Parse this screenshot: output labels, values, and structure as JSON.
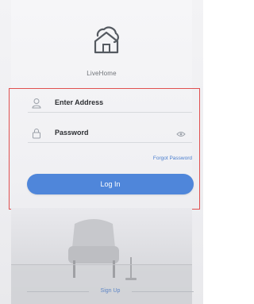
{
  "brand": {
    "name": "LiveHome",
    "logo_icon": "house-cloud-icon"
  },
  "form": {
    "address": {
      "placeholder": "Enter Address",
      "icon": "user-icon"
    },
    "password": {
      "placeholder": "Password",
      "icon": "lock-icon",
      "toggle_icon": "eye-icon"
    },
    "forgot_label": "Forgot Password",
    "login_label": "Log In"
  },
  "footer": {
    "signup_label": "Sign Up"
  },
  "colors": {
    "accent": "#4f86da",
    "highlight_border": "#e05050",
    "link": "#4b7fcf"
  }
}
